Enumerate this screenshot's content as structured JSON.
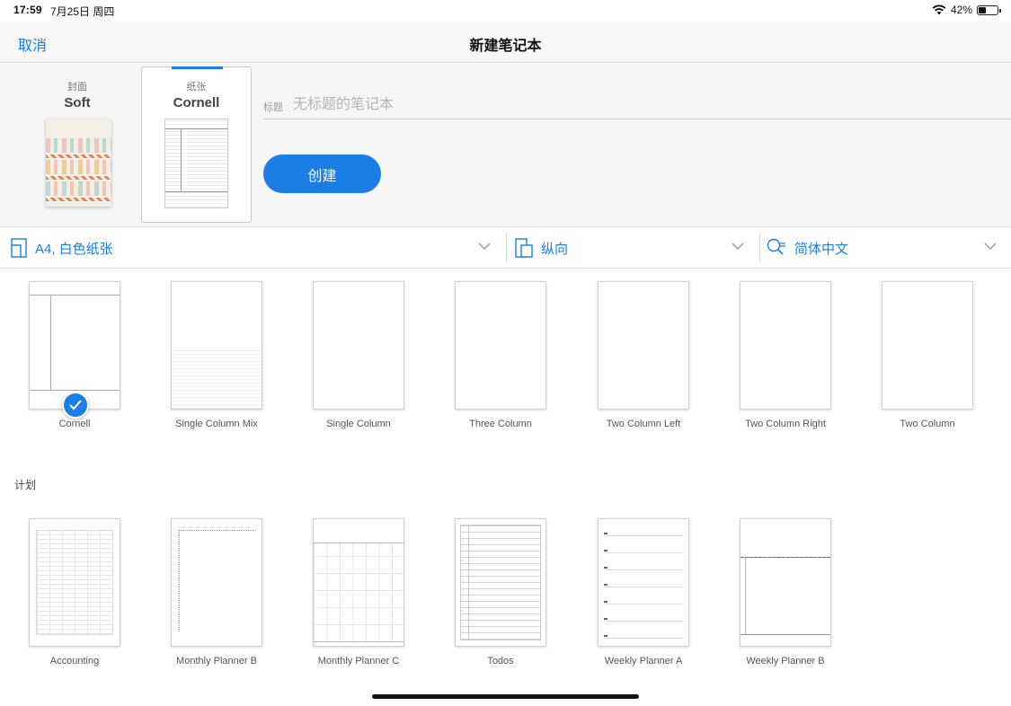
{
  "status_bar": {
    "time": "17:59",
    "date": "7月25日 周四",
    "battery": "42%",
    "battery_level": 0.42
  },
  "navbar": {
    "cancel": "取消",
    "title": "新建笔记本"
  },
  "cover": {
    "label": "封面",
    "name": "Soft"
  },
  "paper": {
    "label": "纸张",
    "name": "Cornell"
  },
  "title_field": {
    "label": "标题",
    "placeholder": "无标题的笔记本",
    "value": ""
  },
  "create_button": "创建",
  "options": {
    "paper_size": "A4, 白色纸张",
    "orientation": "纵向",
    "language": "简体中文"
  },
  "templates": [
    {
      "name": "Cornell",
      "selected": true
    },
    {
      "name": "Single Column Mix",
      "selected": false
    },
    {
      "name": "Single Column",
      "selected": false
    },
    {
      "name": "Three Column",
      "selected": false
    },
    {
      "name": "Two Column Left",
      "selected": false
    },
    {
      "name": "Two Column Right",
      "selected": false
    },
    {
      "name": "Two Column",
      "selected": false
    }
  ],
  "planner_section": "计划",
  "planners": [
    {
      "name": "Accounting"
    },
    {
      "name": "Monthly Planner B"
    },
    {
      "name": "Monthly Planner C"
    },
    {
      "name": "Todos"
    },
    {
      "name": "Weekly Planner A"
    },
    {
      "name": "Weekly Planner B"
    }
  ],
  "colors": {
    "accent": "#1a7ee6"
  }
}
